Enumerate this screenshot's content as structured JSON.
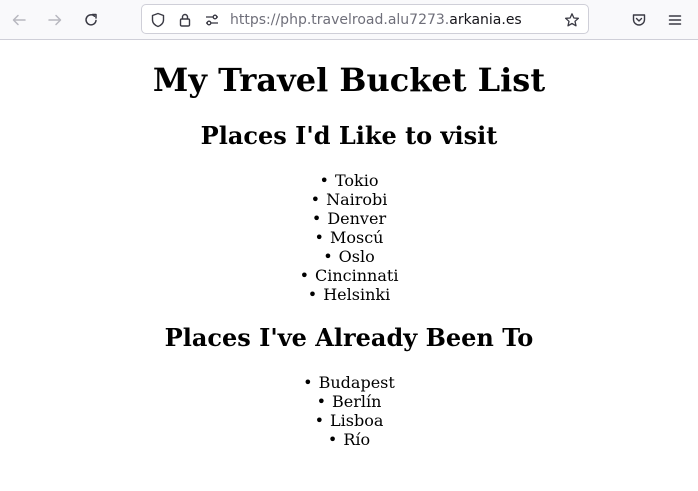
{
  "browser": {
    "url_prefix": "https://php.travelroad.alu7273.",
    "url_domain": "arkania.es",
    "icons": {
      "back": "arrow-left-icon",
      "forward": "arrow-right-icon",
      "reload": "reload-icon",
      "shield": "tracking-protection-shield-icon",
      "lock": "lock-icon",
      "permissions": "permissions-icon",
      "bookmark": "star-icon",
      "pocket": "pocket-icon",
      "menu": "hamburger-menu-icon"
    }
  },
  "page": {
    "title": "My Travel Bucket List",
    "wishlist": {
      "heading": "Places I'd Like to visit",
      "items": [
        "Tokio",
        "Nairobi",
        "Denver",
        "Moscú",
        "Oslo",
        "Cincinnati",
        "Helsinki"
      ]
    },
    "visited": {
      "heading": "Places I've Already Been To",
      "items": [
        "Budapest",
        "Berlín",
        "Lisboa",
        "Río"
      ]
    }
  }
}
